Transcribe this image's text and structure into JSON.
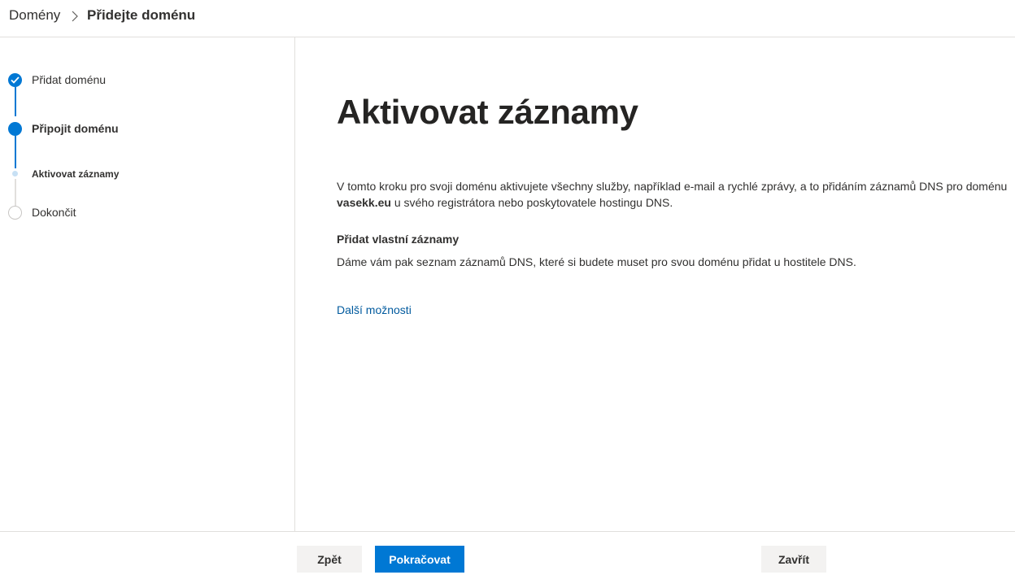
{
  "breadcrumb": {
    "root": "Domény",
    "current": "Přidejte doménu"
  },
  "steps": [
    {
      "label": "Přidat doménu",
      "state": "completed"
    },
    {
      "label": "Připojit doménu",
      "state": "current"
    },
    {
      "label": "Aktivovat záznamy",
      "state": "current-substep"
    },
    {
      "label": "Dokončit",
      "state": "pending"
    }
  ],
  "main": {
    "title": "Aktivovat záznamy",
    "description_before": "V tomto kroku pro svoji doménu aktivujete všechny služby, například e-mail a rychlé zprávy, a to přidáním záznamů DNS pro doménu ",
    "domain_name": "vasekk.eu",
    "description_after": " u svého registrátora nebo poskytovatele hostingu DNS.",
    "section_heading": "Přidat vlastní záznamy",
    "section_text": "Dáme vám pak seznam záznamů DNS, které si budete muset pro svou doménu přidat u hostitele DNS.",
    "more_options_link": "Další možnosti"
  },
  "footer": {
    "back_label": "Zpět",
    "continue_label": "Pokračovat",
    "close_label": "Zavřít"
  },
  "colors": {
    "accent": "#0078d4",
    "link": "#005a9e",
    "border": "#e1dfdd",
    "secondary_button": "#f3f2f1"
  }
}
